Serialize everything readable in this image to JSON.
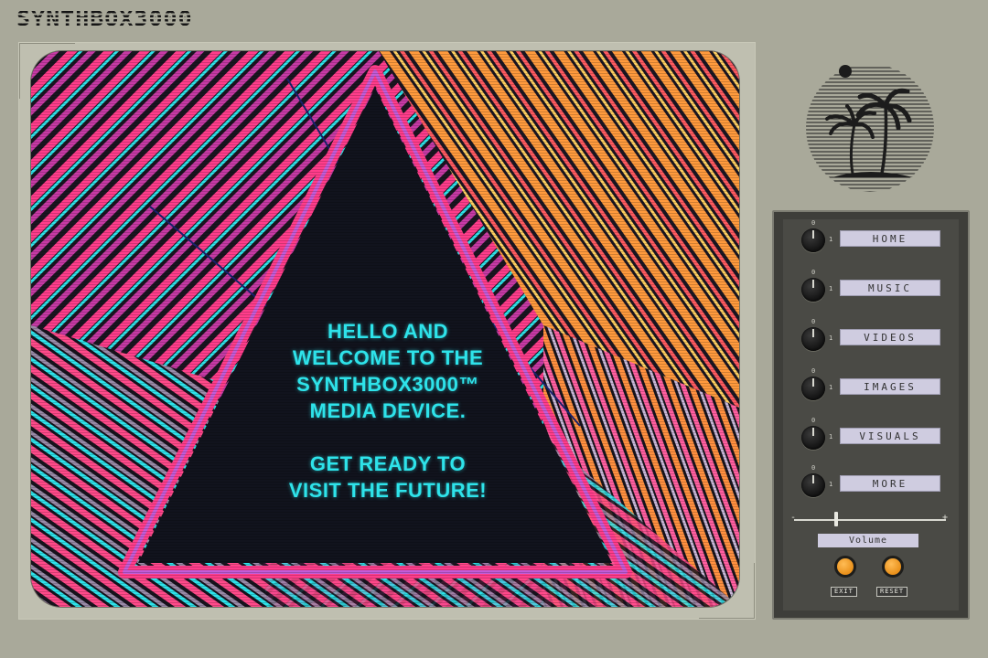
{
  "brand": {
    "logo": "SYNTHBOX3000"
  },
  "screen": {
    "welcome_lines": [
      "HELLO AND",
      "WELCOME TO THE",
      "SYNTHBOX3000™",
      "MEDIA DEVICE.",
      "",
      "GET READY TO",
      "VISIT THE FUTURE!"
    ]
  },
  "emblem": {
    "icon": "palm-trees-sunset-icon"
  },
  "controls": {
    "knob_zero": "0",
    "knob_one": "1",
    "nav": [
      {
        "label": "HOME"
      },
      {
        "label": "MUSIC"
      },
      {
        "label": "VIDEOS"
      },
      {
        "label": "IMAGES"
      },
      {
        "label": "VISUALS"
      },
      {
        "label": "MORE"
      }
    ],
    "slider": {
      "minus": "-",
      "plus": "+",
      "level": 0.28
    },
    "volume_label": "Volume",
    "exit_label": "EXIT",
    "reset_label": "RESET"
  },
  "colors": {
    "background": "#a9a99a",
    "panel": "#3e3e3a",
    "accent_cyan": "#2ee3ea",
    "accent_pink": "#ff3d8b",
    "accent_orange": "#ff8a3d",
    "button_orange": "#f0a030",
    "nav_button": "#cfcce0"
  }
}
